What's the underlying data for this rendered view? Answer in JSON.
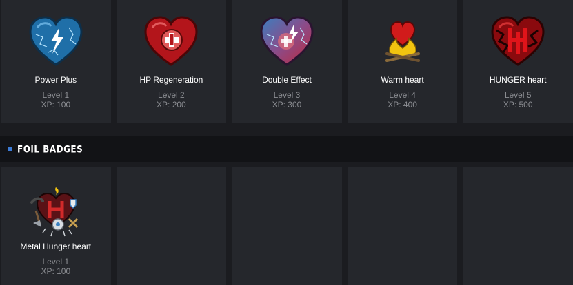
{
  "badges": [
    {
      "name": "Power Plus",
      "level": "Level 1",
      "xp": "XP: 100",
      "icon": "power-plus-heart-icon"
    },
    {
      "name": "HP Regeneration",
      "level": "Level 2",
      "xp": "XP: 200",
      "icon": "hp-regeneration-heart-icon"
    },
    {
      "name": "Double Effect",
      "level": "Level 3",
      "xp": "XP: 300",
      "icon": "double-effect-heart-icon"
    },
    {
      "name": "Warm heart",
      "level": "Level 4",
      "xp": "XP: 400",
      "icon": "warm-heart-campfire-icon"
    },
    {
      "name": "HUNGER heart",
      "level": "Level 5",
      "xp": "XP: 500",
      "icon": "hunger-heart-icon"
    }
  ],
  "foil_section": {
    "title": "FOIL BADGES",
    "accent_color": "#3c7bd6",
    "badges": [
      {
        "name": "Metal Hunger heart",
        "level": "Level 1",
        "xp": "XP: 100",
        "icon": "metal-hunger-heart-icon"
      }
    ]
  }
}
